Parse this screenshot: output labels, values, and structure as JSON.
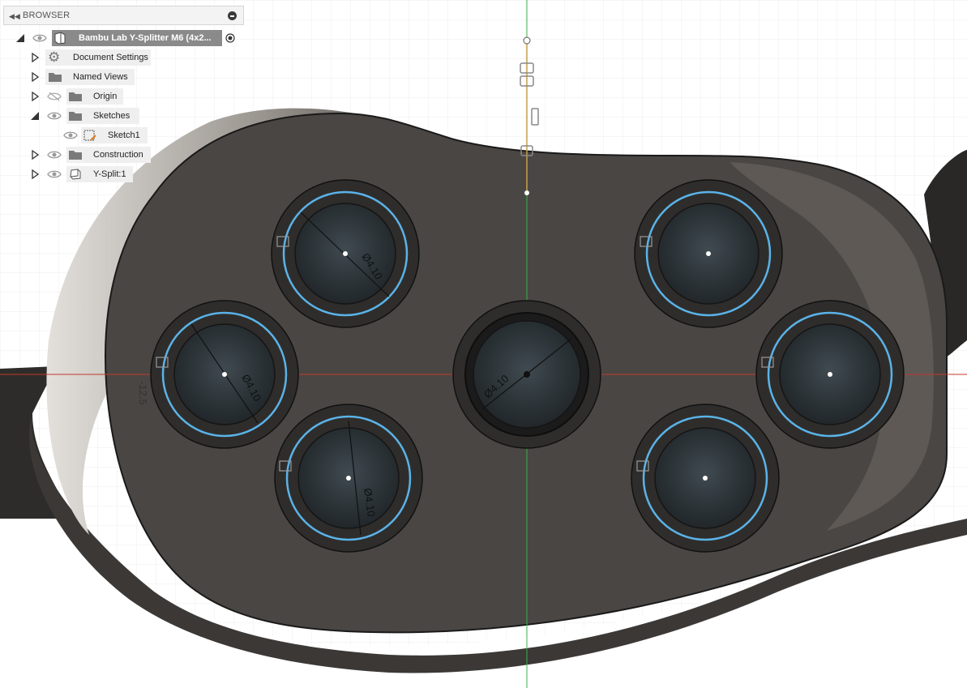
{
  "browser": {
    "title": "BROWSER",
    "root": {
      "label": "Bambu Lab Y-Splitter M6 (4x2...",
      "icon": "component-icon"
    },
    "items": [
      {
        "label": "Document Settings",
        "icon": "gear-icon",
        "expanded": false
      },
      {
        "label": "Named Views",
        "icon": "folder-icon",
        "expanded": false
      },
      {
        "label": "Origin",
        "icon": "folder-icon",
        "expanded": false,
        "visibility": "hidden"
      },
      {
        "label": "Sketches",
        "icon": "folder-icon",
        "expanded": true
      },
      {
        "label": "Sketch1",
        "icon": "sketch-icon"
      },
      {
        "label": "Construction",
        "icon": "folder-icon",
        "expanded": false
      },
      {
        "label": "Y-Split:1",
        "icon": "body-icon",
        "expanded": false
      }
    ]
  },
  "viewport": {
    "dimension_labels": [
      "Ø4.10",
      "Ø4.10",
      "Ø4.10",
      "Ø4.10"
    ],
    "offset_label": "-12.5",
    "colors": {
      "background": "#ffffff",
      "grid": "#e6e6e6",
      "body": "#4a4643",
      "face_outline": "#1f1f1f",
      "sketch_curve": "#5ab3e8",
      "x_axis": "#c0392b",
      "y_axis": "#3cb043",
      "browser_root_highlight": "#8a8a8a"
    }
  }
}
